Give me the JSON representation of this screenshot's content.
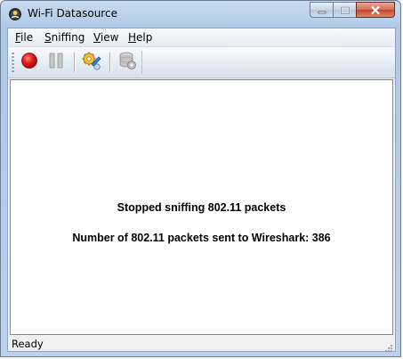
{
  "window": {
    "title": "Wi-Fi Datasource",
    "app_icon": "wifi-datasource-app-icon",
    "caption_buttons": [
      "minimize",
      "maximize",
      "close"
    ]
  },
  "menubar": {
    "items": [
      {
        "label": "File",
        "mnemonic": "F"
      },
      {
        "label": "Sniffing",
        "mnemonic": "S"
      },
      {
        "label": "View",
        "mnemonic": "V"
      },
      {
        "label": "Help",
        "mnemonic": "H"
      }
    ]
  },
  "toolbar": {
    "buttons": [
      {
        "icon": "record-icon",
        "color": "#e11c1c",
        "enabled": true
      },
      {
        "icon": "pause-icon",
        "color": "#a0a0a0",
        "enabled": false
      },
      {
        "icon": "settings-icon",
        "color": "#e0b020",
        "enabled": true
      },
      {
        "icon": "datasource-icon",
        "color": "#a8a8a8",
        "enabled": false
      }
    ]
  },
  "main": {
    "status_line": "Stopped sniffing 802.11 packets",
    "count_line": "Number of 802.11 packets sent to Wireshark: 386"
  },
  "statusbar": {
    "text": "Ready"
  }
}
